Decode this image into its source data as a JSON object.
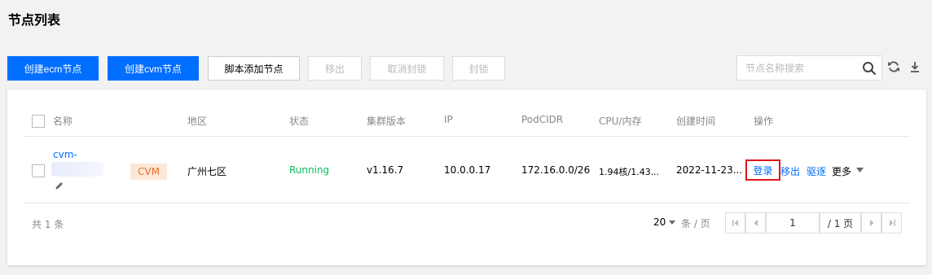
{
  "page": {
    "title": "节点列表"
  },
  "toolbar": {
    "create_ecm": "创建ecm节点",
    "create_cvm": "创建cvm节点",
    "script_add": "脚本添加节点",
    "remove": "移出",
    "uncordon": "取消封锁",
    "cordon": "封锁",
    "search_placeholder": "节点名称搜索"
  },
  "table": {
    "headers": {
      "name": "名称",
      "region": "地区",
      "status": "状态",
      "version": "集群版本",
      "ip": "IP",
      "podcidr": "PodCIDR",
      "cpu_mem": "CPU/内存",
      "created": "创建时间",
      "actions": "操作"
    },
    "rows": [
      {
        "name": "cvm-",
        "type_tag": "CVM",
        "region": "广州七区",
        "status": "Running",
        "version": "v1.16.7",
        "ip": "10.0.0.17",
        "podcidr": "172.16.0.0/26",
        "cpu_mem": "1.94核/1.43...",
        "created": "2022-11-23...",
        "actions": {
          "login": "登录",
          "remove": "移出",
          "drain": "驱逐",
          "more": "更多"
        }
      }
    ]
  },
  "footer": {
    "total_prefix": "共",
    "total_count": "1",
    "total_suffix": "条",
    "page_size": "20",
    "per_page": "条 / 页",
    "current_page": "1",
    "total_pages": "/ 1 页"
  },
  "colors": {
    "primary": "#006eff",
    "running": "#0abf5b",
    "tag_bg": "#fde8d8",
    "tag_text": "#e5702c",
    "highlight": "#e0141e"
  }
}
